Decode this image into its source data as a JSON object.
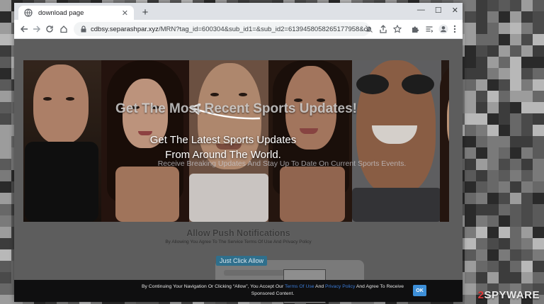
{
  "browser": {
    "tab": {
      "title": "download page",
      "close_glyph": "✕",
      "favicon": "globe-icon"
    },
    "new_tab_glyph": "+",
    "window_controls": {
      "minimize": "—",
      "maximize": "☐",
      "close": "✕"
    },
    "toolbar": {
      "url_host": "cdbsy.separashpar.xyz",
      "url_rest": "/MRN?tag_id=600304&sub_id1=&sub_id2=6139458058265177958&cookie_id...",
      "icons": [
        "back-icon",
        "forward-icon",
        "reload-icon",
        "home-icon",
        "lock-icon",
        "notifications-blocked-icon",
        "share-icon",
        "bookmark-star-icon",
        "extensions-icon",
        "reading-list-icon",
        "profile-icon",
        "menu-icon"
      ]
    }
  },
  "page": {
    "headline": "Get The Most Recent Sports Updates!",
    "subline": "Get The Latest Sports Updates From Around The World.",
    "small_text": "Receive Breaking Updates And Stay Up To Date On Current Sports Events.",
    "push_title": "Allow Push Notifications",
    "push_subtitle": "By Allowing You Agree To The Service Terms Of Use And Privacy Policy",
    "click_allow": "Just Click Allow",
    "consent": {
      "text_before": "By Continuing Your Navigation Or Clicking “Allow”, You Accept Our ",
      "terms_link": "Terms Of Use",
      "text_and": " And ",
      "privacy_link": "Privacy Policy",
      "text_after": " And Agree To Receive Sponsored Content.",
      "ok_label": "OK"
    }
  },
  "watermark": {
    "prefix": "2",
    "suffix": "SPYWARE"
  },
  "colors": {
    "consent_bg": "#0f0f10",
    "ok_button": "#3d8fd8",
    "link": "#3b7bd6",
    "watermark_accent": "#e23a3a"
  }
}
